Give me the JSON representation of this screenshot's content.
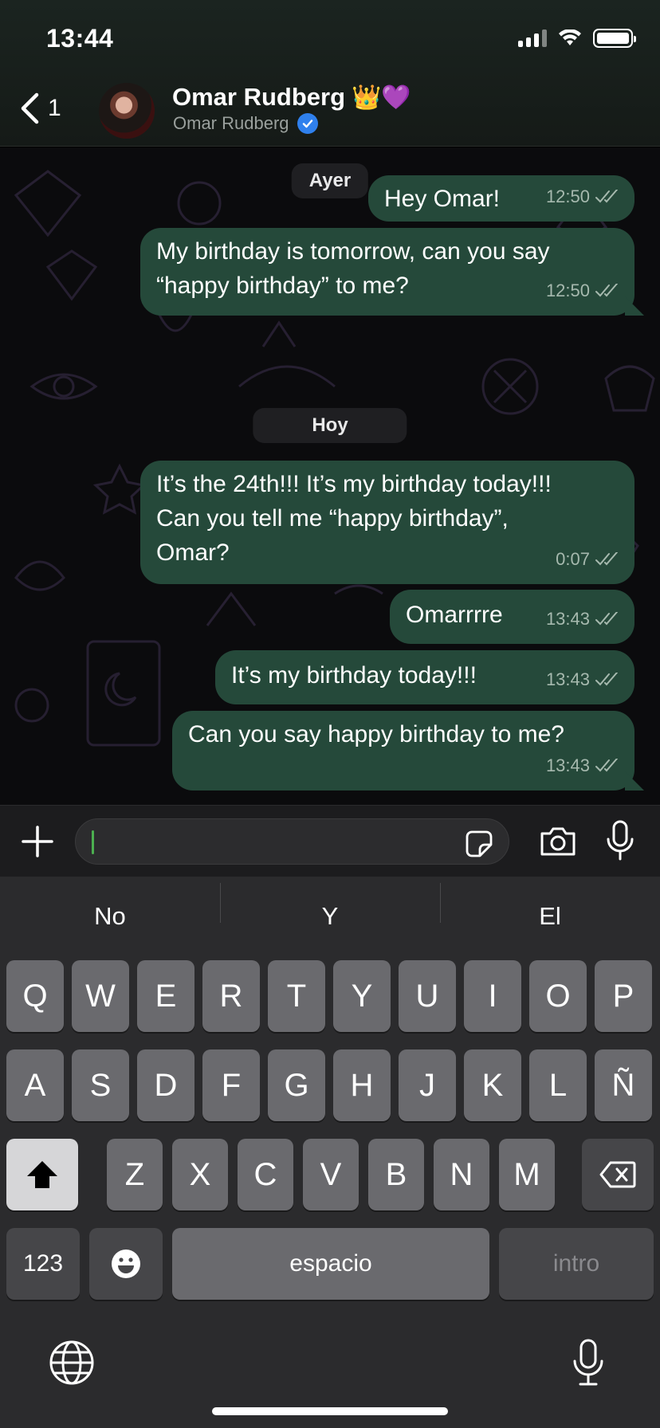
{
  "status": {
    "time": "13:44"
  },
  "header": {
    "back_count": "1",
    "name": "Omar Rudberg",
    "name_emojis": "👑💜",
    "subtitle": "Omar Rudberg"
  },
  "chat": {
    "days": [
      "Ayer",
      "Hoy"
    ],
    "messages": [
      {
        "line1": "Hey Omar!",
        "line2": "",
        "line3": "",
        "time": "12:50"
      },
      {
        "line1": "My birthday is tomorrow, can you say",
        "line2": "“happy birthday” to me?",
        "line3": "",
        "time": "12:50"
      },
      {
        "line1": "It’s the 24th!!! It’s my birthday today!!!",
        "line2": "Can you tell me “happy birthday”,",
        "line3": "Omar?",
        "time": "0:07"
      },
      {
        "line1": "Omarrrre",
        "line2": "",
        "line3": "",
        "time": "13:43"
      },
      {
        "line1": "It’s my birthday today!!!",
        "line2": "",
        "line3": "",
        "time": "13:43"
      },
      {
        "line1": "Can you say happy birthday to me?",
        "line2": "",
        "line3": "",
        "time": "13:43"
      }
    ]
  },
  "input": {
    "placeholder": ""
  },
  "keyboard": {
    "suggestions": [
      "No",
      "Y",
      "El"
    ],
    "row1": [
      "Q",
      "W",
      "E",
      "R",
      "T",
      "Y",
      "U",
      "I",
      "O",
      "P"
    ],
    "row2": [
      "A",
      "S",
      "D",
      "F",
      "G",
      "H",
      "J",
      "K",
      "L",
      "Ñ"
    ],
    "row3": [
      "Z",
      "X",
      "C",
      "V",
      "B",
      "N",
      "M"
    ],
    "numbers_label": "123",
    "space_label": "espacio",
    "return_label": "intro"
  },
  "colors": {
    "bubble": "#25493a",
    "keyboard_bg": "#2b2b2d",
    "key": "#6a6a6e",
    "verified": "#2f80ed"
  }
}
